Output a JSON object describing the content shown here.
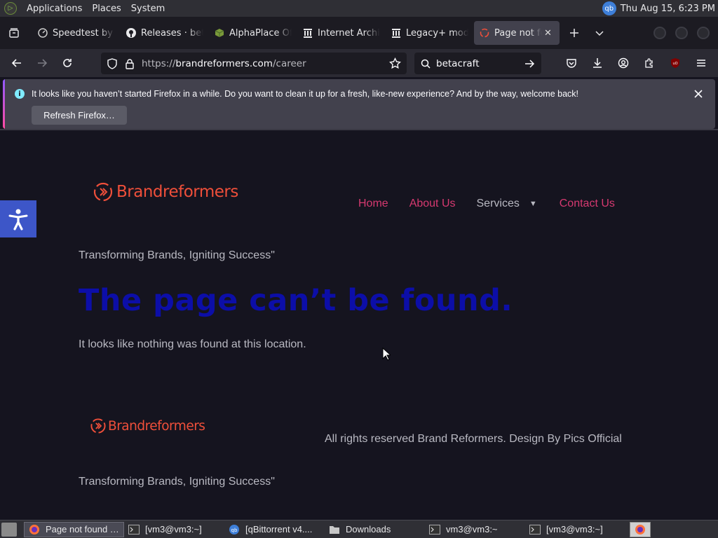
{
  "system_panel": {
    "menus": [
      "Applications",
      "Places",
      "System"
    ],
    "clock": "Thu Aug 15,  6:23 PM",
    "tray_icon": "qb"
  },
  "tabs": [
    {
      "title": "Speedtest by Ookla",
      "icon": "speedometer-icon"
    },
    {
      "title": "Releases · betacraft",
      "icon": "github-icon"
    },
    {
      "title": "AlphaPlace Official",
      "icon": "block-icon"
    },
    {
      "title": "Internet Archive",
      "icon": "archive-icon"
    },
    {
      "title": "Legacy+ mod",
      "icon": "archive-icon"
    },
    {
      "title": "Page not found",
      "icon": "site-favicon",
      "active": true
    }
  ],
  "navbar": {
    "url_prefix": "https://",
    "url_host": "brandreformers.com",
    "url_path": "/career",
    "search_value": "betacraft"
  },
  "notification": {
    "message": "It looks like you haven’t started Firefox in a while. Do you want to clean it up for a fresh, like-new experience? And by the way, welcome back!",
    "button_label": "Refresh Firefox…"
  },
  "site": {
    "logo_text": "Brandreformers",
    "nav": {
      "home": "Home",
      "about": "About Us",
      "services": "Services",
      "contact": "Contact Us"
    },
    "tagline": "Transforming Brands, Igniting Success\"",
    "error_title": "The page can’t be found.",
    "error_text": "It looks like nothing was found at this location.",
    "footer_logo_text": "Brandreformers",
    "copyright": "All rights reserved Brand Reformers. Design By Pics Official",
    "footer_tagline": "Transforming Brands, Igniting Success\""
  },
  "taskbar": [
    {
      "label": "Page not found …",
      "icon": "firefox-icon",
      "active": true
    },
    {
      "label": "[vm3@vm3:~]",
      "icon": "terminal-icon"
    },
    {
      "label": "[qBittorrent v4....",
      "icon": "qbittorrent-icon"
    },
    {
      "label": "Downloads",
      "icon": "folder-icon"
    },
    {
      "label": "vm3@vm3:~",
      "icon": "terminal-icon"
    },
    {
      "label": "[vm3@vm3:~]",
      "icon": "terminal-icon"
    }
  ],
  "colors": {
    "accent_link": "#d63970",
    "logo": "#ef4f3a",
    "error_title": "#0c0ea8",
    "page_bg": "#15141f"
  }
}
